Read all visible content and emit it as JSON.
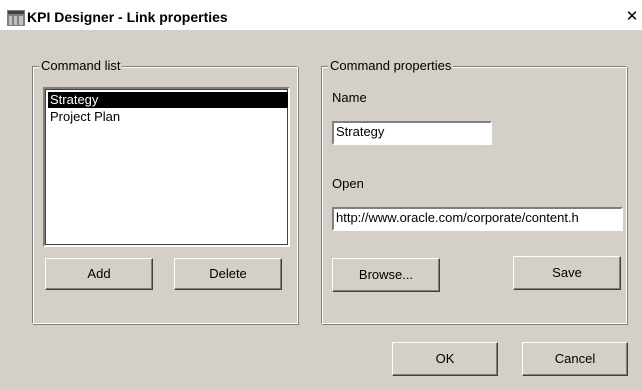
{
  "window": {
    "title": "KPI Designer - Link properties",
    "icon": "app-icon",
    "close_glyph": "✕"
  },
  "command_list": {
    "legend": "Command list",
    "items": [
      {
        "label": "Strategy",
        "selected": true
      },
      {
        "label": "Project Plan",
        "selected": false
      }
    ],
    "add_label": "Add",
    "delete_label": "Delete"
  },
  "command_properties": {
    "legend": "Command properties",
    "name_label": "Name",
    "name_value": "Strategy",
    "open_label": "Open",
    "open_value": "http://www.oracle.com/corporate/content.h",
    "browse_label": "Browse...",
    "save_label": "Save"
  },
  "footer": {
    "ok_label": "OK",
    "cancel_label": "Cancel"
  }
}
